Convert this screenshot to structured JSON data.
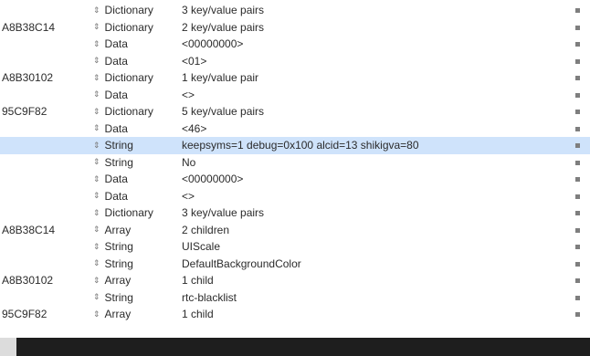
{
  "rows": [
    {
      "key": "",
      "type": "Dictionary",
      "value": "3 key/value pairs",
      "selected": false
    },
    {
      "key": "A8B38C14",
      "type": "Dictionary",
      "value": "2 key/value pairs",
      "selected": false
    },
    {
      "key": "",
      "type": "Data",
      "value": "<00000000>",
      "selected": false
    },
    {
      "key": "",
      "type": "Data",
      "value": "<01>",
      "selected": false
    },
    {
      "key": "A8B30102",
      "type": "Dictionary",
      "value": "1 key/value pair",
      "selected": false
    },
    {
      "key": "",
      "type": "Data",
      "value": "<>",
      "selected": false
    },
    {
      "key": "95C9F82",
      "type": "Dictionary",
      "value": "5 key/value pairs",
      "selected": false
    },
    {
      "key": "",
      "type": "Data",
      "value": "<46>",
      "selected": false
    },
    {
      "key": "",
      "type": "String",
      "value": "keepsyms=1 debug=0x100 alcid=13 shikigva=80",
      "selected": true
    },
    {
      "key": "",
      "type": "String",
      "value": "No",
      "selected": false
    },
    {
      "key": "",
      "type": "Data",
      "value": "<00000000>",
      "selected": false
    },
    {
      "key": "",
      "type": "Data",
      "value": "<>",
      "selected": false
    },
    {
      "key": "",
      "type": "Dictionary",
      "value": "3 key/value pairs",
      "selected": false
    },
    {
      "key": "A8B38C14",
      "type": "Array",
      "value": "2 children",
      "selected": false
    },
    {
      "key": "",
      "type": "String",
      "value": "UIScale",
      "selected": false
    },
    {
      "key": "",
      "type": "String",
      "value": "DefaultBackgroundColor",
      "selected": false
    },
    {
      "key": "A8B30102",
      "type": "Array",
      "value": "1 child",
      "selected": false
    },
    {
      "key": "",
      "type": "String",
      "value": "rtc-blacklist",
      "selected": false
    },
    {
      "key": "95C9F82",
      "type": "Array",
      "value": "1 child",
      "selected": false
    }
  ],
  "stepper_glyph": "⇕"
}
